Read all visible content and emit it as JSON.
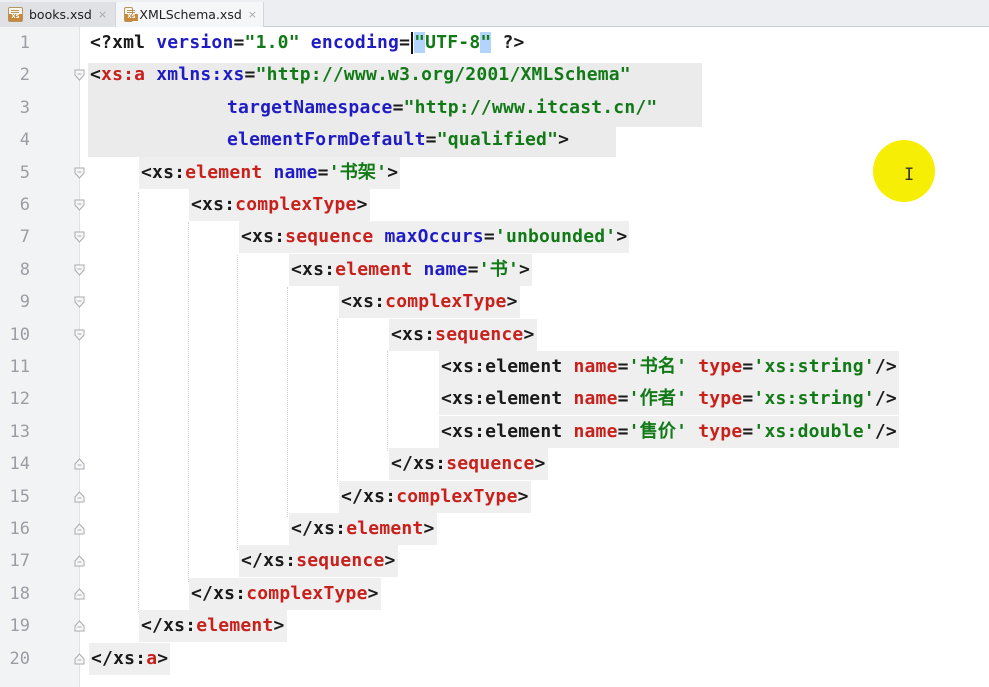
{
  "tabs": [
    {
      "label": "books.xsd",
      "icon": "xsd-file-icon",
      "active": false
    },
    {
      "label": "XMLSchema.xsd",
      "icon": "xsd-file-icon",
      "active": true
    }
  ],
  "tab_close_glyph": "×",
  "file_icon_text": "XS",
  "cursor": {
    "glyph": "I"
  },
  "lines": [
    {
      "num": "1"
    },
    {
      "num": "2"
    },
    {
      "num": "3"
    },
    {
      "num": "4"
    },
    {
      "num": "5"
    },
    {
      "num": "6"
    },
    {
      "num": "7"
    },
    {
      "num": "8"
    },
    {
      "num": "9"
    },
    {
      "num": "10"
    },
    {
      "num": "11"
    },
    {
      "num": "12"
    },
    {
      "num": "13"
    },
    {
      "num": "14"
    },
    {
      "num": "15"
    },
    {
      "num": "16"
    },
    {
      "num": "17"
    },
    {
      "num": "18"
    },
    {
      "num": "19"
    },
    {
      "num": "20"
    }
  ],
  "code": {
    "l1": {
      "open": "<?xml ",
      "a1": "version",
      "eq1": "=",
      "v1": "\"1.0\"",
      "sp": " ",
      "a2": "encoding",
      "eq2": "=",
      "q1": "\"",
      "v2": "UTF-8",
      "q2": "\"",
      "close": " ?>"
    },
    "l2": {
      "lt": "<",
      "tag": "xs:a",
      "sp": " ",
      "a1": "xmlns:xs",
      "eq": "=",
      "v1": "\"http://www.w3.org/2001/XMLSchema\""
    },
    "l3": {
      "a": "targetNamespace",
      "eq": "=",
      "v": "\"http://www.itcast.cn/\""
    },
    "l4": {
      "a": "elementFormDefault",
      "eq": "=",
      "v": "\"qualified\"",
      "gt": ">"
    },
    "l5": {
      "lt": "<",
      "ns": "xs:",
      "tag": "element",
      "sp": " ",
      "a": "name",
      "eq": "=",
      "q1": "'",
      "v": "书架",
      "q2": "'",
      "gt": ">"
    },
    "l6": {
      "lt": "<",
      "ns": "xs:",
      "tag": "complexType",
      "gt": ">"
    },
    "l7": {
      "lt": "<",
      "ns": "xs:",
      "tag": "sequence",
      "sp": " ",
      "a": "maxOccurs",
      "eq": "=",
      "v": "'unbounded'",
      "gt": ">"
    },
    "l8": {
      "lt": "<",
      "ns": "xs:",
      "tag": "element",
      "sp": " ",
      "a": "name",
      "eq": "=",
      "q1": "'",
      "v": "书",
      "q2": "'",
      "gt": ">"
    },
    "l9": {
      "lt": "<",
      "ns": "xs:",
      "tag": "complexType",
      "gt": ">"
    },
    "l10": {
      "lt": "<",
      "ns": "xs:",
      "tag": "sequence",
      "gt": ">"
    },
    "l11": {
      "lt": "<",
      "ns": "xs:element",
      "sp": " ",
      "a1": "name",
      "eq1": "=",
      "q1": "'",
      "v1": "书名",
      "q2": "'",
      "sp2": " ",
      "a2": "type",
      "eq2": "=",
      "v2": "'xs:string'",
      "end": "/>"
    },
    "l12": {
      "lt": "<",
      "ns": "xs:element",
      "sp": " ",
      "a1": "name",
      "eq1": "=",
      "q1": "'",
      "v1": "作者",
      "q2": "'",
      "sp2": " ",
      "a2": "type",
      "eq2": "=",
      "v2": "'xs:string'",
      "end": "/>"
    },
    "l13": {
      "lt": "<",
      "ns": "xs:element",
      "sp": " ",
      "a1": "name",
      "eq1": "=",
      "q1": "'",
      "v1": "售价",
      "q2": "'",
      "sp2": " ",
      "a2": "type",
      "eq2": "=",
      "v2": "'xs:double'",
      "end": "/>"
    },
    "l14": {
      "lt": "</",
      "ns": "xs:",
      "tag": "sequence",
      "gt": ">"
    },
    "l15": {
      "lt": "</",
      "ns": "xs:",
      "tag": "complexType",
      "gt": ">"
    },
    "l16": {
      "lt": "</",
      "ns": "xs:",
      "tag": "element",
      "gt": ">"
    },
    "l17": {
      "lt": "</",
      "ns": "xs:",
      "tag": "sequence",
      "gt": ">"
    },
    "l18": {
      "lt": "</",
      "ns": "xs:",
      "tag": "complexType",
      "gt": ">"
    },
    "l19": {
      "lt": "</",
      "ns": "xs:",
      "tag": "element",
      "gt": ">"
    },
    "l20": {
      "lt": "</",
      "ns": "xs:",
      "tag": "a",
      "gt": ">"
    }
  },
  "colors": {
    "tag": "#c8211c",
    "attr": "#1f1cc4",
    "value": "#117a17",
    "punct": "#1a1a1a",
    "cursor_highlight": "#f7ee05",
    "selection": "#b3d4fb"
  }
}
